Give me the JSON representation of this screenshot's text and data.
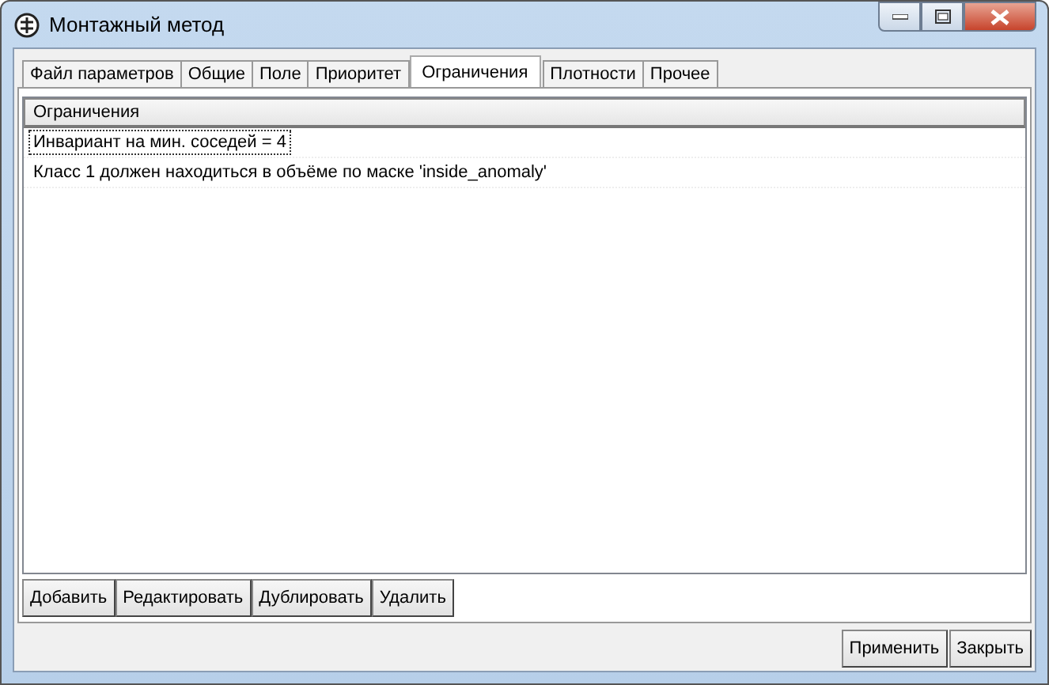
{
  "window": {
    "title": "Монтажный метод"
  },
  "tabs": [
    {
      "label": "Файл параметров",
      "selected": false
    },
    {
      "label": "Общие",
      "selected": false
    },
    {
      "label": "Поле",
      "selected": false
    },
    {
      "label": "Приоритет",
      "selected": false
    },
    {
      "label": "Ограничения",
      "selected": true
    },
    {
      "label": "Плотности",
      "selected": false
    },
    {
      "label": "Прочее",
      "selected": false
    }
  ],
  "list": {
    "header": "Ограничения",
    "rows": [
      {
        "text": "Инвариант на мин. соседей = 4",
        "selected": true
      },
      {
        "text": "Класс 1 должен находиться в объёме по маске 'inside_anomaly'",
        "selected": false
      }
    ]
  },
  "list_buttons": [
    "Добавить",
    "Редактировать",
    "Дублировать",
    "Удалить"
  ],
  "dialog_buttons": [
    "Применить",
    "Закрыть"
  ]
}
